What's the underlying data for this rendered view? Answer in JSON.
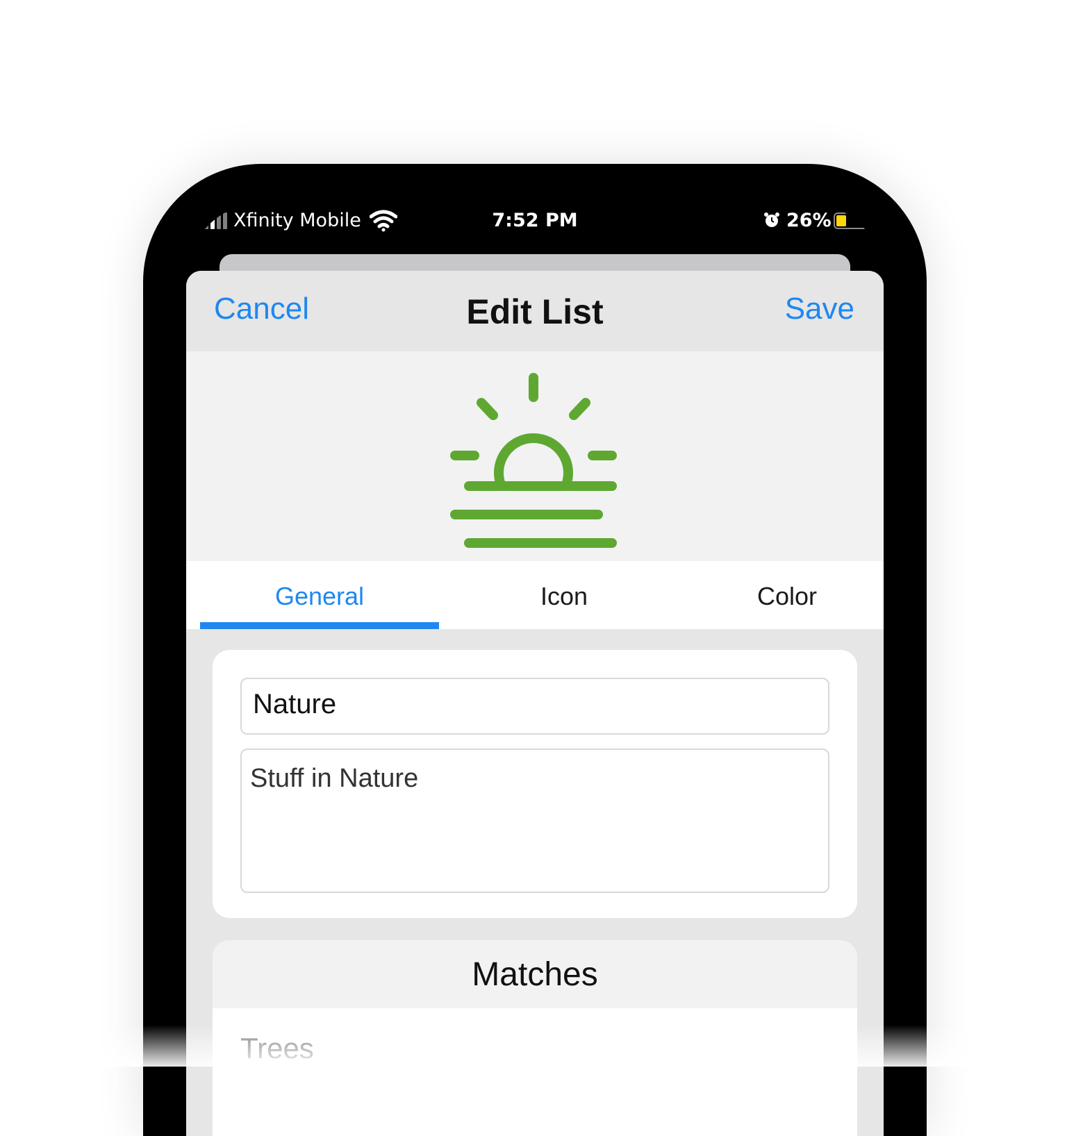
{
  "status_bar": {
    "carrier": "Xfinity Mobile",
    "time": "7:52 PM",
    "battery_percent": "26%",
    "battery_level": 0.26,
    "battery_color": "#ffd60a",
    "icons": [
      "signal-icon",
      "wifi-icon",
      "alarm-icon",
      "battery-icon"
    ]
  },
  "nav": {
    "cancel_label": "Cancel",
    "title": "Edit List",
    "save_label": "Save"
  },
  "hero": {
    "icon": "sunrise-icon",
    "icon_color": "#5ea832"
  },
  "tabs": [
    {
      "label": "General",
      "selected": true
    },
    {
      "label": "Icon",
      "selected": false
    },
    {
      "label": "Color",
      "selected": false
    }
  ],
  "form": {
    "name_value": "Nature",
    "description_value": "Stuff in Nature"
  },
  "matches": {
    "title": "Matches",
    "items": [
      "Trees"
    ]
  },
  "colors": {
    "accent": "#1f87f0",
    "icon_green": "#5ea832"
  }
}
